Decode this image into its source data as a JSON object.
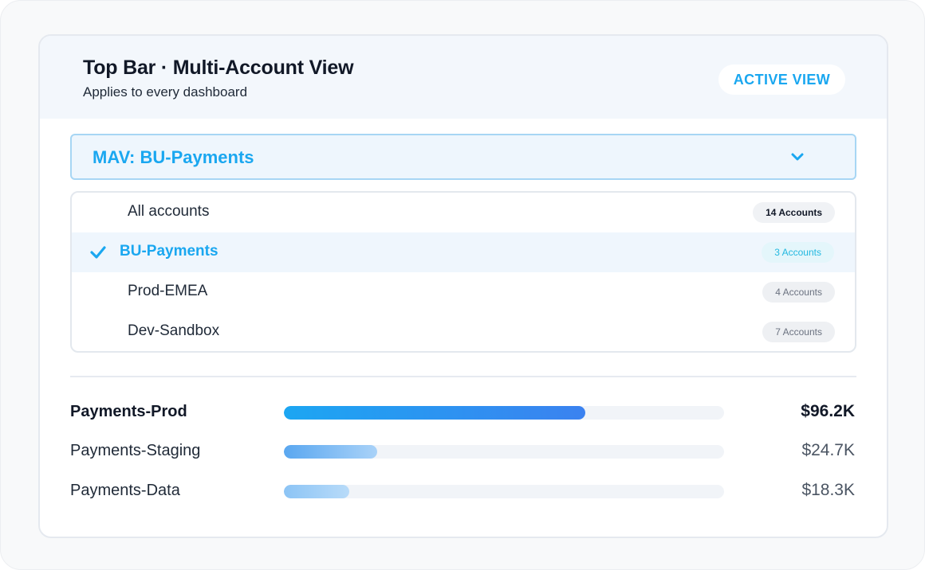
{
  "header": {
    "title": "Top Bar · Multi-Account View",
    "subtitle": "Applies to every dashboard",
    "active_label": "ACTIVE VIEW"
  },
  "selector": {
    "label": "MAV: BU-Payments",
    "icon": "chevron-down-icon"
  },
  "dropdown": {
    "options": [
      {
        "label": "All accounts",
        "count": "14 Accounts",
        "selected": false
      },
      {
        "label": "BU-Payments",
        "count": "3 Accounts",
        "selected": true
      },
      {
        "label": "Prod-EMEA",
        "count": "4 Accounts",
        "selected": false
      },
      {
        "label": "Dev-Sandbox",
        "count": "7 Accounts",
        "selected": false
      }
    ]
  },
  "costs": [
    {
      "name": "Payments-Prod",
      "value": "$96.2K",
      "fill_fraction": 0.685
    },
    {
      "name": "Payments-Staging",
      "value": "$24.7K",
      "fill_fraction": 0.212
    },
    {
      "name": "Payments-Data",
      "value": "$18.3K",
      "fill_fraction": 0.149
    }
  ],
  "colors": {
    "accent": "#1aa7f0",
    "selected_row_bg": "#eff6fd",
    "bar_primary_start": "#1ca6f2",
    "bar_primary_end": "#3b82f0"
  }
}
